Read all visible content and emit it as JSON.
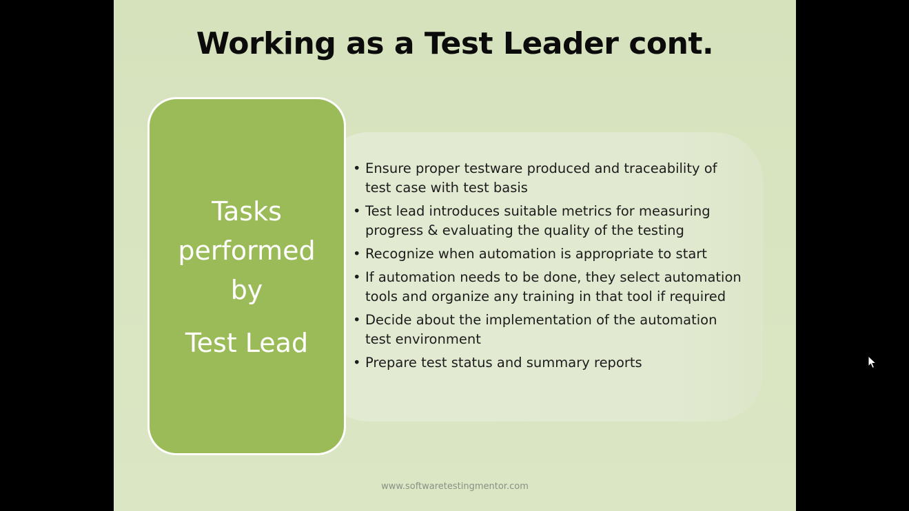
{
  "slide": {
    "title": "Working as a Test Leader cont.",
    "task_box": {
      "lines": [
        "Tasks",
        "performed",
        "by",
        "Test Lead"
      ]
    },
    "bullets": [
      "Ensure proper testware produced and traceability of test case with test basis",
      "Test lead introduces suitable metrics for measuring progress & evaluating the quality of the testing",
      "Recognize when automation is appropriate to start",
      "If automation needs to be done, they select automation tools and organize any training in that tool if required",
      "Decide about the implementation of the automation test environment",
      "Prepare test status and summary reports"
    ],
    "bullet_glyph": "•",
    "footer_url": "www.softwaretestingmentor.com"
  },
  "icons": {
    "cursor": "mouse-pointer-icon"
  },
  "colors": {
    "slide_background": "#d9e5c1",
    "task_box_fill": "#9bbb59",
    "task_box_border": "#ffffff",
    "content_panel": "#e2ead2",
    "title_text": "#0b0b0b",
    "outside_background": "#000000"
  }
}
